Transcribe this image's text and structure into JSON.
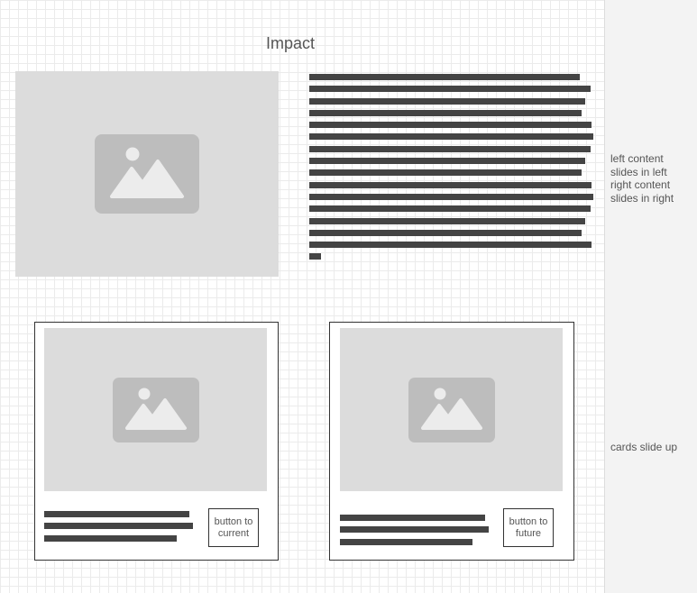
{
  "page": {
    "title": "Impact"
  },
  "hero": {
    "image_icon": "image-placeholder-icon",
    "text_line_count": 16
  },
  "cards": [
    {
      "image_icon": "image-placeholder-icon",
      "button_label_line1": "button to",
      "button_label_line2": "current"
    },
    {
      "image_icon": "image-placeholder-icon",
      "button_label_line1": "button to",
      "button_label_line2": "future"
    }
  ],
  "notes": {
    "hero_line1": "left content",
    "hero_line2": "slides in left",
    "hero_line3": "right content",
    "hero_line4": "slides in right",
    "cards_note": "cards slide up"
  },
  "colors": {
    "placeholder": "#dcdcdc",
    "icon": "#bdbdbd",
    "text_bar": "#444444",
    "side_panel": "#f3f3f3"
  }
}
